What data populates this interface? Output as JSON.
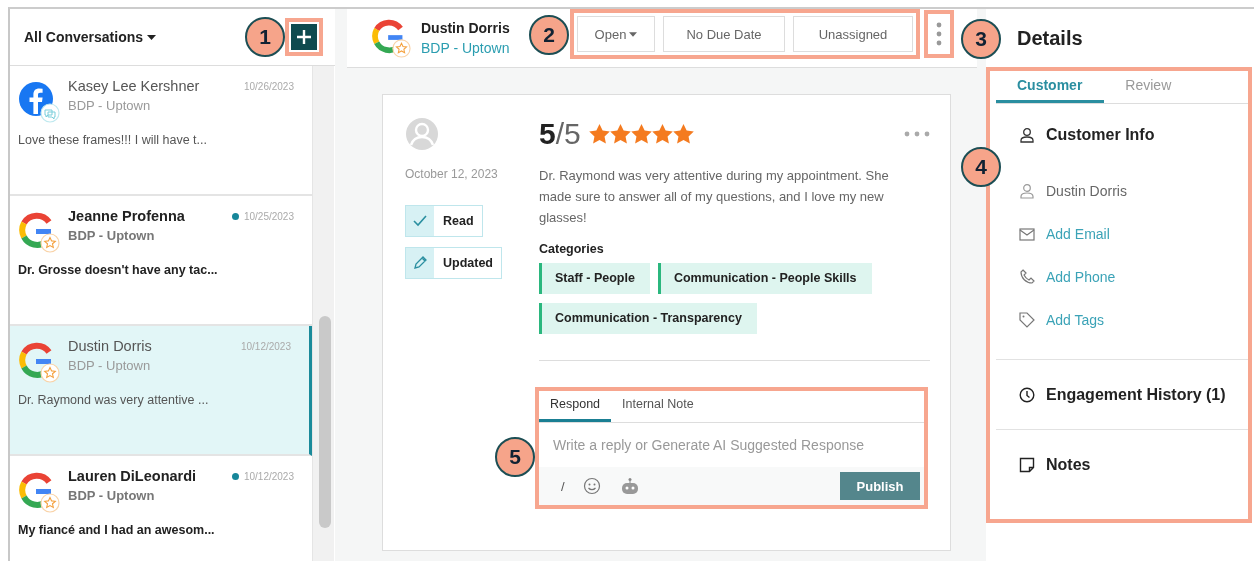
{
  "conversation_list": {
    "filter": "All Conversations"
  },
  "conversations": [
    {
      "name": "Kasey Lee Kershner",
      "location": "BDP - Uptown",
      "date": "10/26/2023",
      "preview": "Love these frames!!! I will have t...",
      "kind": "facebook",
      "unread": false,
      "selected": false
    },
    {
      "name": "Jeanne Profenna",
      "location": "BDP - Uptown",
      "date": "10/25/2023",
      "preview": "Dr. Grosse doesn't have any tac...",
      "kind": "google",
      "unread": true,
      "selected": false
    },
    {
      "name": "Dustin Dorris",
      "location": "BDP - Uptown",
      "date": "10/12/2023",
      "preview": "Dr. Raymond was very attentive ...",
      "kind": "google",
      "unread": false,
      "selected": true
    },
    {
      "name": "Lauren DiLeonardi",
      "location": "BDP - Uptown",
      "date": "10/12/2023",
      "preview": "My fiancé and I had an awesom...",
      "kind": "google",
      "unread": true,
      "selected": false
    }
  ],
  "header": {
    "name": "Dustin Dorris",
    "location": "BDP - Uptown",
    "status": "Open",
    "due": "No Due Date",
    "assignee": "Unassigned"
  },
  "review": {
    "date": "October 12, 2023",
    "score": "5",
    "out_of": "/5",
    "stars": 5,
    "text": "Dr. Raymond was very attentive during my appointment. She made sure to answer all of my questions, and I love my new glasses!",
    "flags": [
      {
        "label": "Read",
        "kind": "check"
      },
      {
        "label": "Updated",
        "kind": "edit"
      }
    ],
    "categories_title": "Categories",
    "categories": [
      "Staff - People",
      "Communication - People Skills",
      "Communication - Transparency"
    ]
  },
  "composer": {
    "tabs": [
      {
        "label": "Respond",
        "selected": true
      },
      {
        "label": "Internal Note",
        "selected": false
      }
    ],
    "placeholder": "Write a reply or Generate AI Suggested Response",
    "slash": "/",
    "publish": "Publish"
  },
  "details": {
    "title": "Details",
    "tabs": [
      {
        "label": "Customer",
        "selected": true
      },
      {
        "label": "Review",
        "selected": false
      }
    ],
    "info_title": "Customer Info",
    "name": "Dustin Dorris",
    "links": [
      {
        "label": "Add Email",
        "kind": "email"
      },
      {
        "label": "Add Phone",
        "kind": "phone"
      },
      {
        "label": "Add Tags",
        "kind": "tag"
      }
    ],
    "sections": [
      {
        "label": "Engagement History (1)",
        "kind": "history"
      },
      {
        "label": "Notes",
        "kind": "notes"
      }
    ]
  },
  "callouts": [
    {
      "label": "1"
    },
    {
      "label": "2"
    },
    {
      "label": "3"
    },
    {
      "label": "4"
    },
    {
      "label": "5"
    }
  ]
}
